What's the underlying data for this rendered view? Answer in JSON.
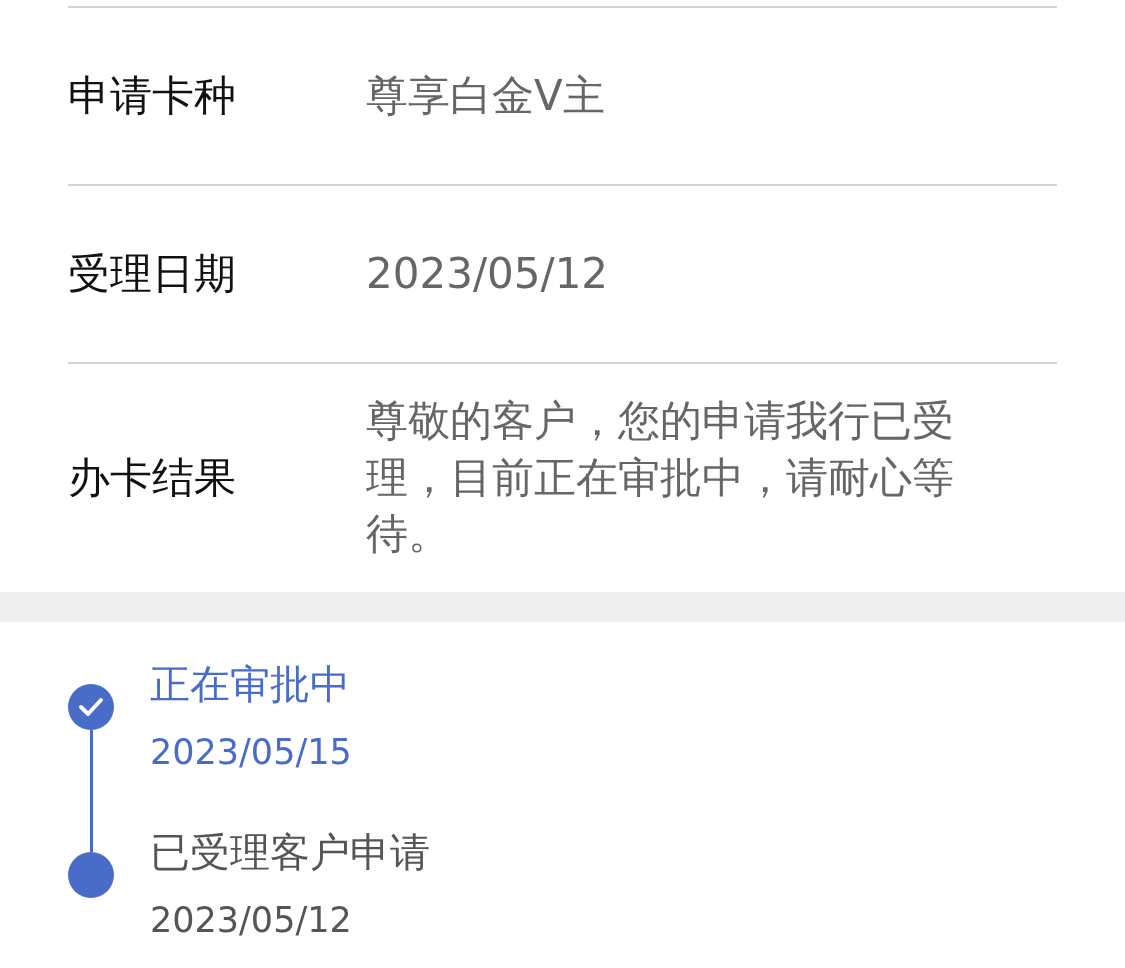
{
  "rows": [
    {
      "label": "申请卡种",
      "value": "尊享白金V主"
    },
    {
      "label": "受理日期",
      "value": "2023/05/12"
    },
    {
      "label": "办卡结果",
      "value": "尊敬的客户，您的申请我行已受理，目前正在审批中，请耐心等待。"
    }
  ],
  "timeline": [
    {
      "title": "正在审批中",
      "date": "2023/05/15",
      "current": true
    },
    {
      "title": "已受理客户申请",
      "date": "2023/05/12",
      "current": false
    }
  ]
}
